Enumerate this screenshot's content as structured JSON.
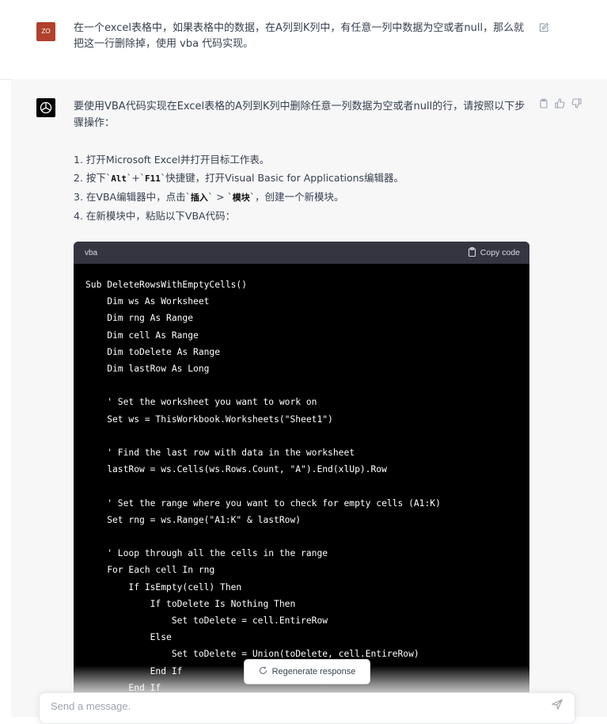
{
  "user": {
    "avatar_text": "ZO",
    "message": "在一个excel表格中，如果表格中的数据，在A列到K列中，有任意一列中数据为空或者null，那么就把这一行删除掉，使用 vba 代码实现。"
  },
  "assistant": {
    "intro": "要使用VBA代码实现在Excel表格的A列到K列中删除任意一列数据为空或者null的行，请按照以下步骤操作：",
    "steps": {
      "s1": {
        "num": "1.",
        "text": "打开Microsoft Excel并打开目标工作表。"
      },
      "s2": {
        "num": "2.",
        "pre": "按下`",
        "k1": "Alt",
        "mid": "`+`",
        "k2": "F11",
        "post": "`快捷键，打开Visual Basic for Applications编辑器。"
      },
      "s3": {
        "num": "3.",
        "pre": "在VBA编辑器中，点击`",
        "k1": "插入",
        "mid": "` > `",
        "k2": "模块",
        "post": "`，创建一个新模块。"
      },
      "s4": {
        "num": "4.",
        "text": "在新模块中，粘贴以下VBA代码："
      }
    },
    "code": {
      "language": "vba",
      "copy_label": "Copy code",
      "text": "Sub DeleteRowsWithEmptyCells()\n    Dim ws As Worksheet\n    Dim rng As Range\n    Dim cell As Range\n    Dim toDelete As Range\n    Dim lastRow As Long\n\n    ' Set the worksheet you want to work on\n    Set ws = ThisWorkbook.Worksheets(\"Sheet1\")\n\n    ' Find the last row with data in the worksheet\n    lastRow = ws.Cells(ws.Rows.Count, \"A\").End(xlUp).Row\n\n    ' Set the range where you want to check for empty cells (A1:K)\n    Set rng = ws.Range(\"A1:K\" & lastRow)\n\n    ' Loop through all the cells in the range\n    For Each cell In rng\n        If IsEmpty(cell) Then\n            If toDelete Is Nothing Then\n                Set toDelete = cell.EntireRow\n            Else\n                Set toDelete = Union(toDelete, cell.EntireRow)\n            End If\n        End If"
    }
  },
  "regenerate_label": "Regenerate response",
  "composer": {
    "placeholder": "Send a message."
  },
  "icons": {
    "edit": "edit-icon",
    "copy": "clipboard-icon",
    "thumbs_up": "thumbs-up-icon",
    "thumbs_down": "thumbs-down-icon",
    "regenerate": "refresh-icon",
    "send": "send-icon"
  },
  "colors": {
    "user_avatar": "#b0412c",
    "code_bg": "#000000",
    "code_header": "#343541",
    "assistant_bg": "#f7f7f8"
  }
}
